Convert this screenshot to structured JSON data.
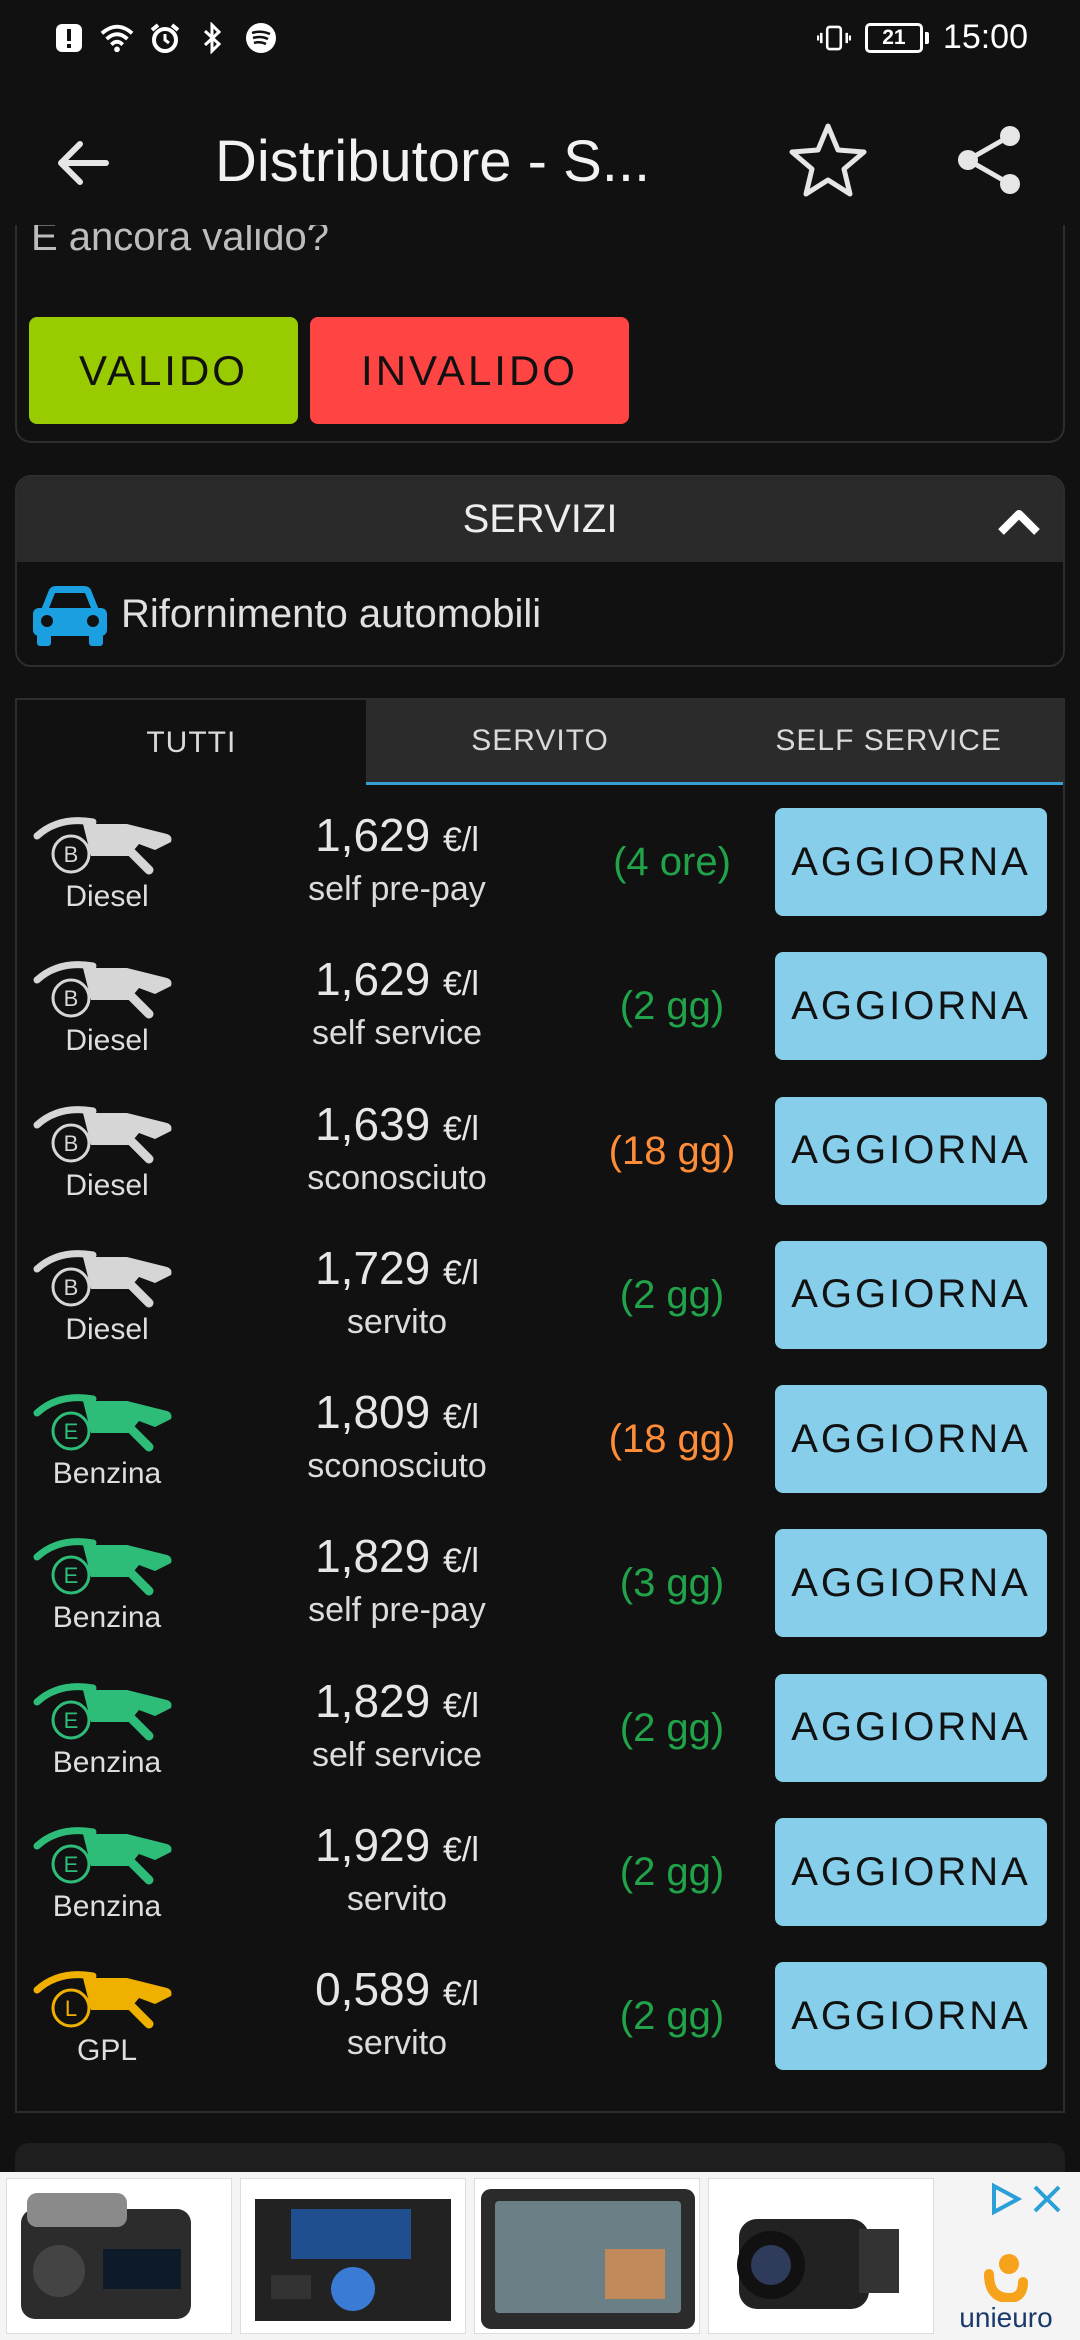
{
  "status_bar": {
    "time": "15:00",
    "battery": "21"
  },
  "app_bar": {
    "title": "Distributore - S..."
  },
  "validity": {
    "question": "È ancora valido?",
    "valid_label": "VALIDO",
    "invalid_label": "INVALIDO"
  },
  "services": {
    "header": "SERVIZI",
    "items": [
      {
        "label": "Rifornimento automobili"
      }
    ]
  },
  "tabs": [
    {
      "label": "TUTTI"
    },
    {
      "label": "SERVITO"
    },
    {
      "label": "SELF SERVICE"
    }
  ],
  "unit": "€/l",
  "update_label": "AGGIORNA",
  "prices": [
    {
      "fuel": "Diesel",
      "letter": "B",
      "price": "1,629",
      "mode": "self pre-pay",
      "age": "(4 ore)",
      "age_status": "fresh"
    },
    {
      "fuel": "Diesel",
      "letter": "B",
      "price": "1,629",
      "mode": "self service",
      "age": "(2 gg)",
      "age_status": "fresh"
    },
    {
      "fuel": "Diesel",
      "letter": "B",
      "price": "1,639",
      "mode": "sconosciuto",
      "age": "(18 gg)",
      "age_status": "old"
    },
    {
      "fuel": "Diesel",
      "letter": "B",
      "price": "1,729",
      "mode": "servito",
      "age": "(2 gg)",
      "age_status": "fresh"
    },
    {
      "fuel": "Benzina",
      "letter": "E",
      "price": "1,809",
      "mode": "sconosciuto",
      "age": "(18 gg)",
      "age_status": "old"
    },
    {
      "fuel": "Benzina",
      "letter": "E",
      "price": "1,829",
      "mode": "self pre-pay",
      "age": "(3 gg)",
      "age_status": "fresh"
    },
    {
      "fuel": "Benzina",
      "letter": "E",
      "price": "1,829",
      "mode": "self service",
      "age": "(2 gg)",
      "age_status": "fresh"
    },
    {
      "fuel": "Benzina",
      "letter": "E",
      "price": "1,929",
      "mode": "servito",
      "age": "(2 gg)",
      "age_status": "fresh"
    },
    {
      "fuel": "GPL",
      "letter": "L",
      "price": "0,589",
      "mode": "servito",
      "age": "(2 gg)",
      "age_status": "fresh"
    }
  ],
  "fuel_colors": {
    "Diesel": "#d6d6d6",
    "Benzina": "#2ebd78",
    "GPL": "#f0b000"
  },
  "ad": {
    "brand": "unieuro",
    "products": [
      "clock radio",
      "car stereo",
      "smart display",
      "camcorder"
    ]
  }
}
